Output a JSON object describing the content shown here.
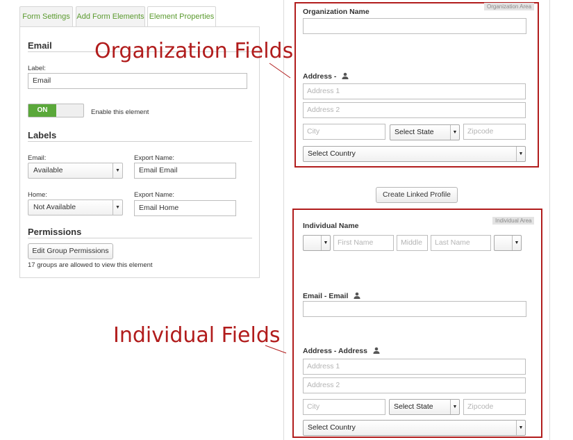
{
  "tabs": [
    {
      "label": "Form Settings",
      "active": false
    },
    {
      "label": "Add Form Elements",
      "active": false
    },
    {
      "label": "Element Properties",
      "active": true
    }
  ],
  "element": {
    "title": "Email",
    "label_caption": "Label:",
    "label_value": "Email",
    "toggle_label": "ON",
    "enable_text": "Enable this element"
  },
  "labels": {
    "title": "Labels",
    "rows": [
      {
        "name": "Email:",
        "select": "Available",
        "export_caption": "Export Name:",
        "export_value": "Email Email"
      },
      {
        "name": "Home:",
        "select": "Not Available",
        "export_caption": "Export Name:",
        "export_value": "Email Home"
      }
    ]
  },
  "permissions": {
    "title": "Permissions",
    "button": "Edit Group Permissions",
    "note": "17 groups are allowed to view this element"
  },
  "organization": {
    "tag": "Organization Area",
    "name_title": "Organization Name",
    "address_title": "Address -",
    "address1": "Address 1",
    "address2": "Address 2",
    "city": "City",
    "state": "Select State",
    "zip": "Zipcode",
    "country": "Select Country"
  },
  "linked_button": "Create Linked Profile",
  "individual": {
    "tag": "Individual Area",
    "name_title": "Individual Name",
    "first": "First Name",
    "middle": "Middle",
    "last": "Last Name",
    "email_title": "Email - Email",
    "address_title": "Address - Address",
    "address1": "Address 1",
    "address2": "Address 2",
    "city": "City",
    "state": "Select State",
    "zip": "Zipcode",
    "country": "Select Country"
  },
  "annotations": {
    "org": "Organization Fields",
    "ind": "Individual Fields"
  },
  "colors": {
    "accent_green": "#5aa83a",
    "tab_text": "#5a9a2e",
    "annotation_red": "#b11c1c"
  }
}
